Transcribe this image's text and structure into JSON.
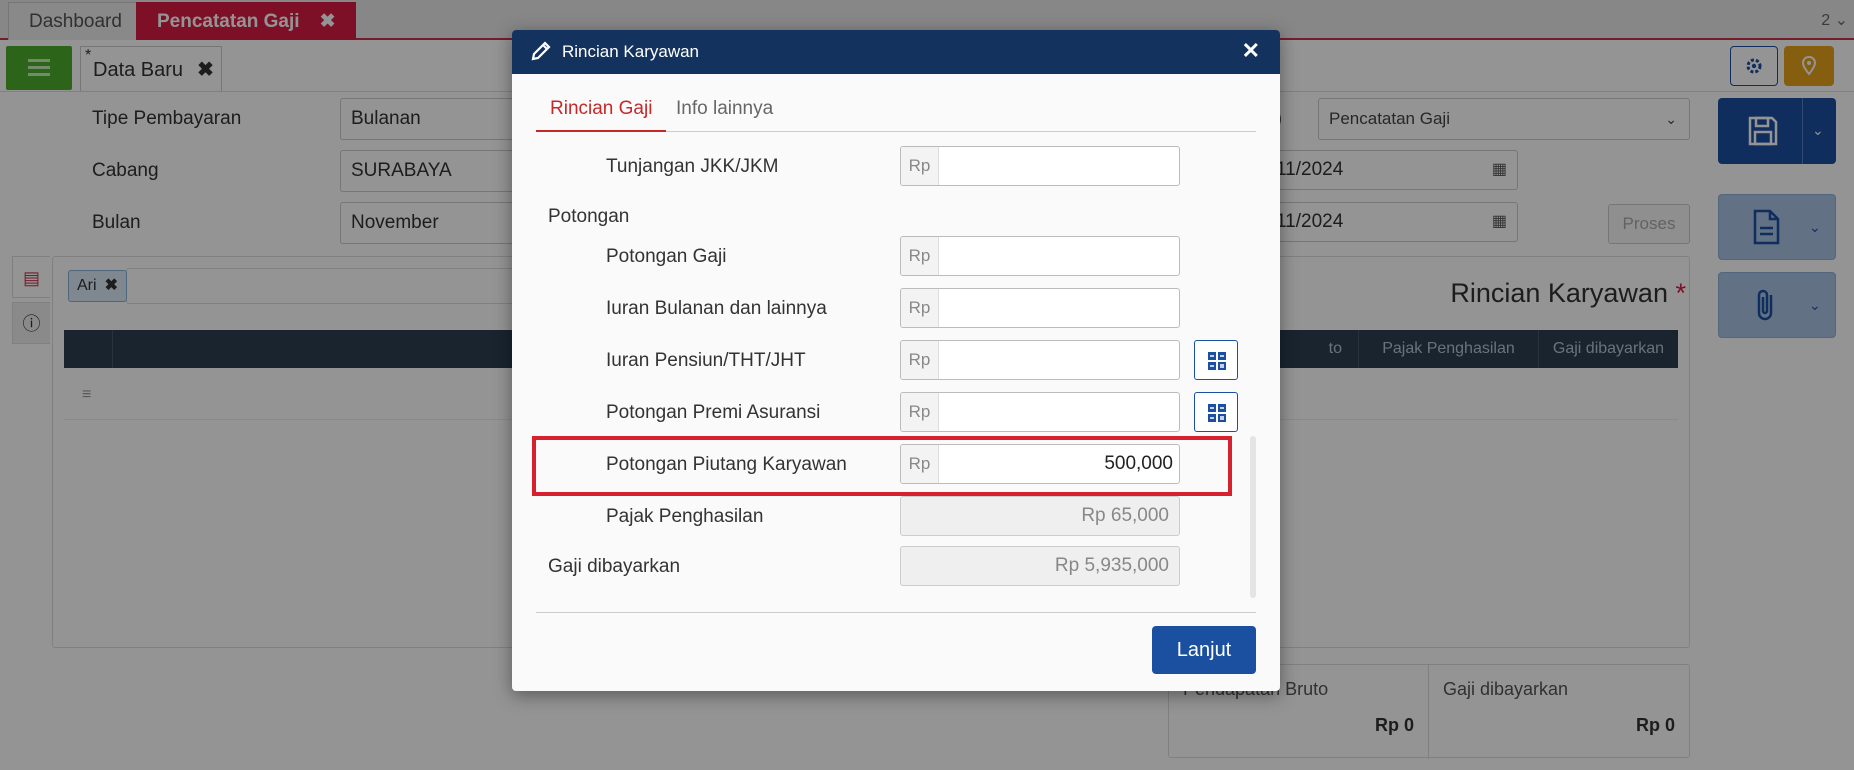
{
  "app_tabs": [
    {
      "label": "Dashboard"
    },
    {
      "label": "Pencatatan Gaji",
      "close": "✖"
    }
  ],
  "tab_count": "2 ⌄",
  "doc_tab": {
    "prefix": "*",
    "label": "Data Baru",
    "close": "✖"
  },
  "form": {
    "tipe_label": "Tipe Pembayaran",
    "tipe_value": "Bulanan",
    "cabang_label": "Cabang",
    "cabang_value": "SURABAYA",
    "bulan_label": "Bulan",
    "bulan_value": "November",
    "right_select": "Pencatatan Gaji",
    "right_partial": ")",
    "date1": "11/2024",
    "date2": "11/2024",
    "proses": "Proses"
  },
  "panel": {
    "tag": "Ari",
    "title": "Rincian Karyawan",
    "required_mark": "*",
    "columns": [
      "to",
      "Pajak Penghasilan",
      "Gaji dibayarkan"
    ]
  },
  "totals": [
    {
      "label": "Pendapatan Bruto",
      "value": "Rp 0"
    },
    {
      "label": "Gaji dibayarkan",
      "value": "Rp 0"
    }
  ],
  "modal": {
    "title": "Rincian Karyawan",
    "close": "✕",
    "tabs": [
      "Rincian Gaji",
      "Info lainnya"
    ],
    "active_tab": "Rincian Gaji",
    "currency_prefix": "Rp",
    "rows": {
      "tunjangan_jkk": {
        "label": "Tunjangan JKK/JKM",
        "value": ""
      },
      "potongan_header": "Potongan",
      "potongan_gaji": {
        "label": "Potongan Gaji",
        "value": ""
      },
      "iuran_bulanan": {
        "label": "Iuran Bulanan dan lainnya",
        "value": ""
      },
      "iuran_pensiun": {
        "label": "Iuran Pensiun/THT/JHT",
        "value": ""
      },
      "premi_asuransi": {
        "label": "Potongan Premi Asuransi",
        "value": ""
      },
      "piutang_karyawan": {
        "label": "Potongan Piutang Karyawan",
        "value": "500,000"
      },
      "pajak_penghasilan": {
        "label": "Pajak Penghasilan",
        "value": "Rp 65,000"
      },
      "gaji_dibayarkan": {
        "label": "Gaji dibayarkan",
        "value": "Rp 5,935,000"
      }
    },
    "submit": "Lanjut"
  },
  "colors": {
    "accent": "#1b4fa0",
    "header": "#14325e",
    "active_tab": "#d81b44",
    "highlight": "#d6212f"
  }
}
